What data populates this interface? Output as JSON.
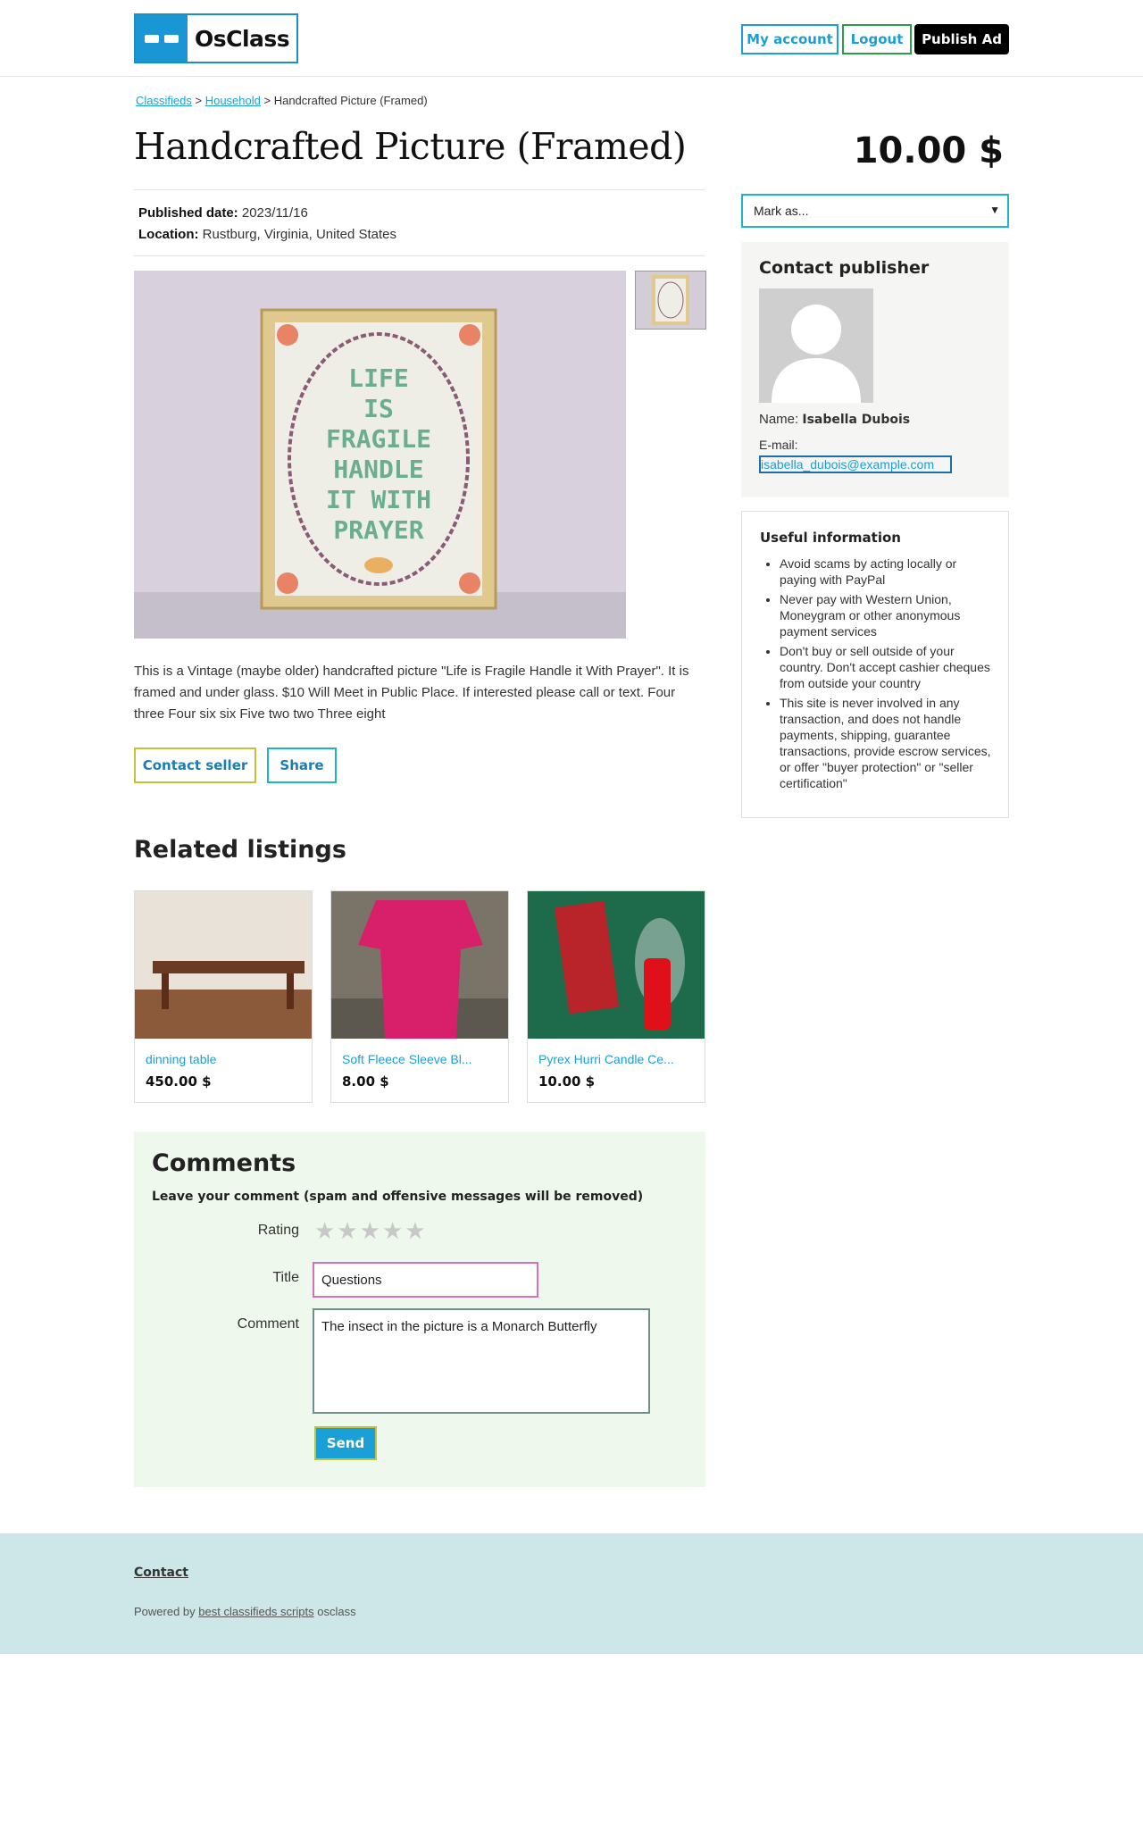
{
  "header": {
    "logo_text": "OsClass",
    "my_account": "My account",
    "logout": "Logout",
    "publish_ad": "Publish Ad"
  },
  "breadcrumb": {
    "items": [
      "Classifieds",
      "Household"
    ],
    "separator": ">",
    "current": "Handcrafted Picture (Framed)"
  },
  "listing": {
    "title": "Handcrafted Picture (Framed)",
    "price": "10.00 $",
    "published_label": "Published date:",
    "published_value": "2023/11/16",
    "location_label": "Location:",
    "location_value": "Rustburg, Virginia, United States",
    "image_text": [
      "LIFE",
      "IS",
      "FRAGILE",
      "HANDLE",
      "IT WITH",
      "PRAYER"
    ],
    "description": "This is a Vintage (maybe older) handcrafted picture \"Life is Fragile Handle it With Prayer\". It is framed and under glass. $10 Will Meet in Public Place. If interested please call or text. Four three Four six six Five two two Three eight",
    "contact_seller": "Contact seller",
    "share": "Share"
  },
  "related": {
    "heading": "Related listings",
    "items": [
      {
        "title": "dinning table",
        "price": "450.00 $"
      },
      {
        "title": "Soft Fleece Sleeve Bl...",
        "price": "8.00 $"
      },
      {
        "title": "Pyrex Hurri Candle Ce...",
        "price": "10.00 $"
      }
    ]
  },
  "comments": {
    "heading": "Comments",
    "notice": "Leave your comment (spam and offensive messages will be removed)",
    "rating_label": "Rating",
    "title_label": "Title",
    "title_value": "Questions",
    "comment_label": "Comment",
    "comment_value": "The insect in the picture is a Monarch Butterfly",
    "send": "Send"
  },
  "sidebar": {
    "mark_as": "Mark as...",
    "contact_heading": "Contact publisher",
    "name_label": "Name:",
    "name_value": "Isabella Dubois",
    "email_label": "E-mail:",
    "email_value": "isabella_dubois@example.com",
    "useful_heading": "Useful information",
    "useful_items": [
      "Avoid scams by acting locally or paying with PayPal",
      "Never pay with Western Union, Moneygram or other anonymous payment services",
      "Don't buy or sell outside of your country. Don't accept cashier cheques from outside your country",
      "This site is never involved in any transaction, and does not handle payments, shipping, guarantee transactions, provide escrow services, or offer \"buyer protection\" or \"seller certification\""
    ]
  },
  "footer": {
    "contact": "Contact",
    "powered_prefix": "Powered by",
    "powered_link": "best classifieds scripts",
    "powered_suffix": "osclass"
  },
  "colors": {
    "accent": "#1a9fd6",
    "comments_bg": "#eff8ec",
    "footer_bg": "#cde6e7"
  }
}
